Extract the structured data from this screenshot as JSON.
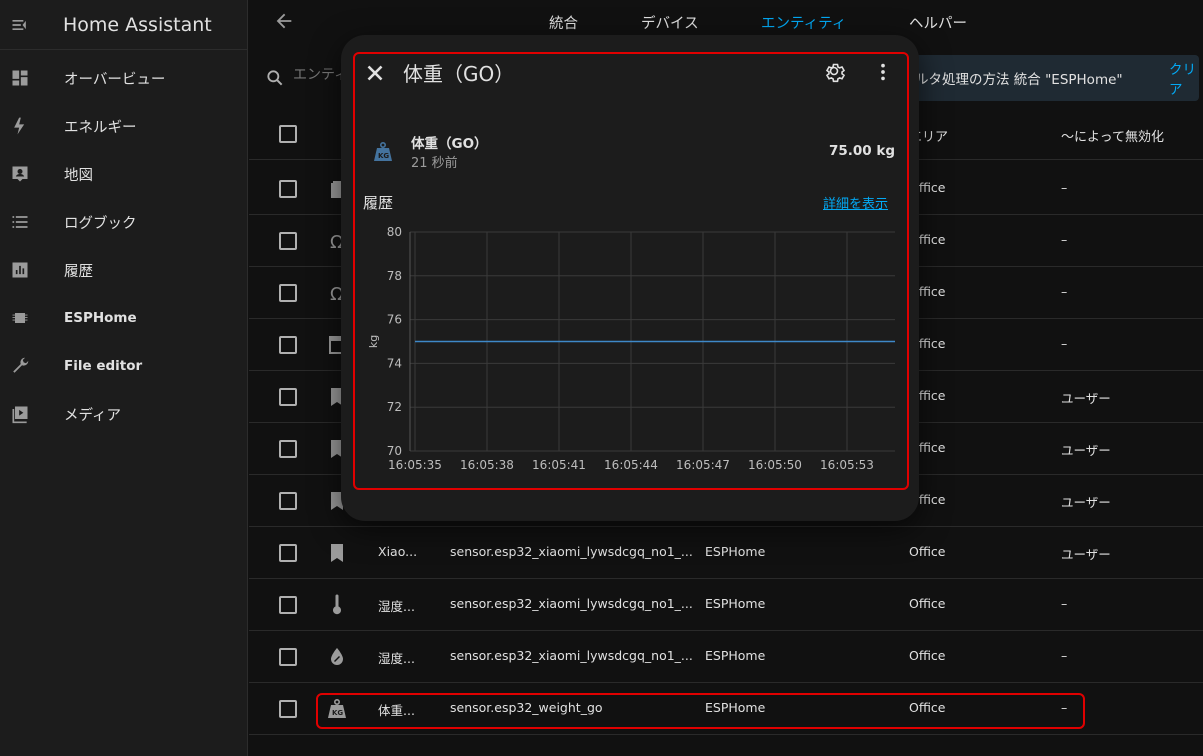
{
  "sidebar": {
    "title": "Home Assistant",
    "items": [
      {
        "label": "オーバービュー",
        "icon": "dashboard-icon"
      },
      {
        "label": "エネルギー",
        "icon": "lightning-icon"
      },
      {
        "label": "地図",
        "icon": "map-account-icon"
      },
      {
        "label": "ログブック",
        "icon": "list-icon"
      },
      {
        "label": "履歴",
        "icon": "chart-box-icon"
      },
      {
        "label": "ESPHome",
        "icon": "chip-icon"
      },
      {
        "label": "File editor",
        "icon": "wrench-icon"
      },
      {
        "label": "メディア",
        "icon": "play-box-icon"
      }
    ]
  },
  "topbar": {
    "tabs": [
      "統合",
      "デバイス",
      "エンティティ",
      "ヘルパー"
    ],
    "active_tab": "エンティティ"
  },
  "search": {
    "placeholder": "エンティ",
    "filter_text": "ルタ処理の方法 統合 \"ESPHome\"",
    "clear_label": "クリア"
  },
  "table": {
    "headers": {
      "area": "エリア",
      "disabled_by": "〜によって無効化"
    },
    "rows": [
      {
        "icon": "battery-icon",
        "name": "",
        "entity_id": "",
        "integration": "",
        "area": "Office",
        "disabled_by": "–"
      },
      {
        "icon": "omega-icon",
        "name": "",
        "entity_id": "",
        "integration": "",
        "area": "Office",
        "disabled_by": "–"
      },
      {
        "icon": "omega-icon",
        "name": "",
        "entity_id": "",
        "integration": "",
        "area": "Office",
        "disabled_by": "–"
      },
      {
        "icon": "calendar-icon",
        "name": "",
        "entity_id": "",
        "integration": "",
        "area": "Office",
        "disabled_by": "–"
      },
      {
        "icon": "bookmark-icon",
        "name": "",
        "entity_id": "",
        "integration": "",
        "area": "Office",
        "disabled_by": "ユーザー"
      },
      {
        "icon": "bookmark-icon",
        "name": "",
        "entity_id": "",
        "integration": "",
        "area": "Office",
        "disabled_by": "ユーザー"
      },
      {
        "icon": "bookmark-icon",
        "name": "",
        "entity_id": "",
        "integration": "",
        "area": "Office",
        "disabled_by": "ユーザー"
      },
      {
        "icon": "bookmark-icon",
        "name": "Xiao...",
        "entity_id": "sensor.esp32_xiaomi_lywsdcgq_no1_...",
        "integration": "ESPHome",
        "area": "Office",
        "disabled_by": "ユーザー"
      },
      {
        "icon": "thermometer-icon",
        "name": "湿度...",
        "entity_id": "sensor.esp32_xiaomi_lywsdcgq_no1_...",
        "integration": "ESPHome",
        "area": "Office",
        "disabled_by": "–"
      },
      {
        "icon": "water-percent-icon",
        "name": "湿度...",
        "entity_id": "sensor.esp32_xiaomi_lywsdcgq_no1_...",
        "integration": "ESPHome",
        "area": "Office",
        "disabled_by": "–"
      },
      {
        "icon": "weight-kg-icon",
        "name": "体重...",
        "entity_id": "sensor.esp32_weight_go",
        "integration": "ESPHome",
        "area": "Office",
        "disabled_by": "–"
      }
    ]
  },
  "dialog": {
    "title": "体重（GO）",
    "entity_name": "体重（GO）",
    "last_changed": "21 秒前",
    "value": "75.00 kg",
    "history_title": "履歴",
    "show_more": "詳細を表示"
  },
  "colors": {
    "accent": "#03a9f4",
    "highlight": "#e00000",
    "line": "#3e88c8"
  },
  "chart_data": {
    "type": "line",
    "ylabel": "kg",
    "ylim": [
      70,
      80
    ],
    "yticks": [
      70,
      72,
      74,
      76,
      78,
      80
    ],
    "xticks": [
      "16:05:35",
      "16:05:38",
      "16:05:41",
      "16:05:44",
      "16:05:47",
      "16:05:50",
      "16:05:53"
    ],
    "series": [
      {
        "x": [
          "16:05:35",
          "16:05:55"
        ],
        "values": [
          75.0,
          75.0
        ]
      }
    ],
    "grid": true
  }
}
